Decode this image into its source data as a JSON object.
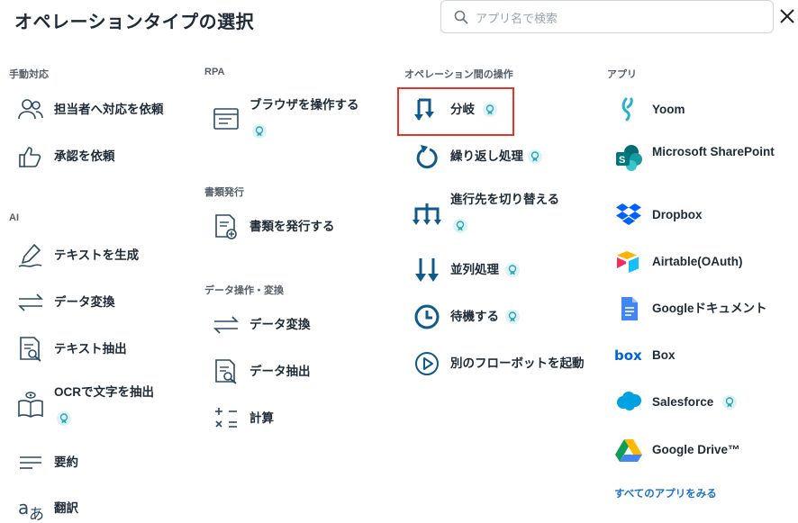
{
  "header": {
    "title": "オペレーションタイプの選択",
    "search_placeholder": "アプリ名で検索"
  },
  "col1": {
    "manual_title": "手動対応",
    "manual": [
      "担当者へ対応を依頼",
      "承認を依頼"
    ],
    "ai_title": "AI",
    "ai": [
      "テキストを生成",
      "データ変換",
      "テキスト抽出",
      "OCRで文字を抽出",
      "要約",
      "翻訳"
    ]
  },
  "col2": {
    "rpa_title": "RPA",
    "rpa": [
      "ブラウザを操作する"
    ],
    "doc_title": "書類発行",
    "doc": [
      "書類を発行する"
    ],
    "data_title": "データ操作・変換",
    "data": [
      "データ変換",
      "データ抽出",
      "計算"
    ]
  },
  "col3": {
    "title": "オペレーション間の操作",
    "items": [
      "分岐",
      "繰り返し処理",
      "進行先を切り替える",
      "並列処理",
      "待機する",
      "別のフローボットを起動"
    ]
  },
  "col4": {
    "title": "アプリ",
    "apps": [
      "Yoom",
      "Microsoft SharePoint",
      "Dropbox",
      "Airtable(OAuth)",
      "Googleドキュメント",
      "Box",
      "Salesforce",
      "Google Drive™"
    ],
    "all_apps_link": "すべてのアプリをみる"
  },
  "colors": {
    "icon": "#2b4a66",
    "accent": "#0f6fb0",
    "highlight": "#e8332c",
    "badge_bg": "#dff3f6",
    "badge_fg": "#2aa7b8",
    "link": "#1a73c9"
  }
}
